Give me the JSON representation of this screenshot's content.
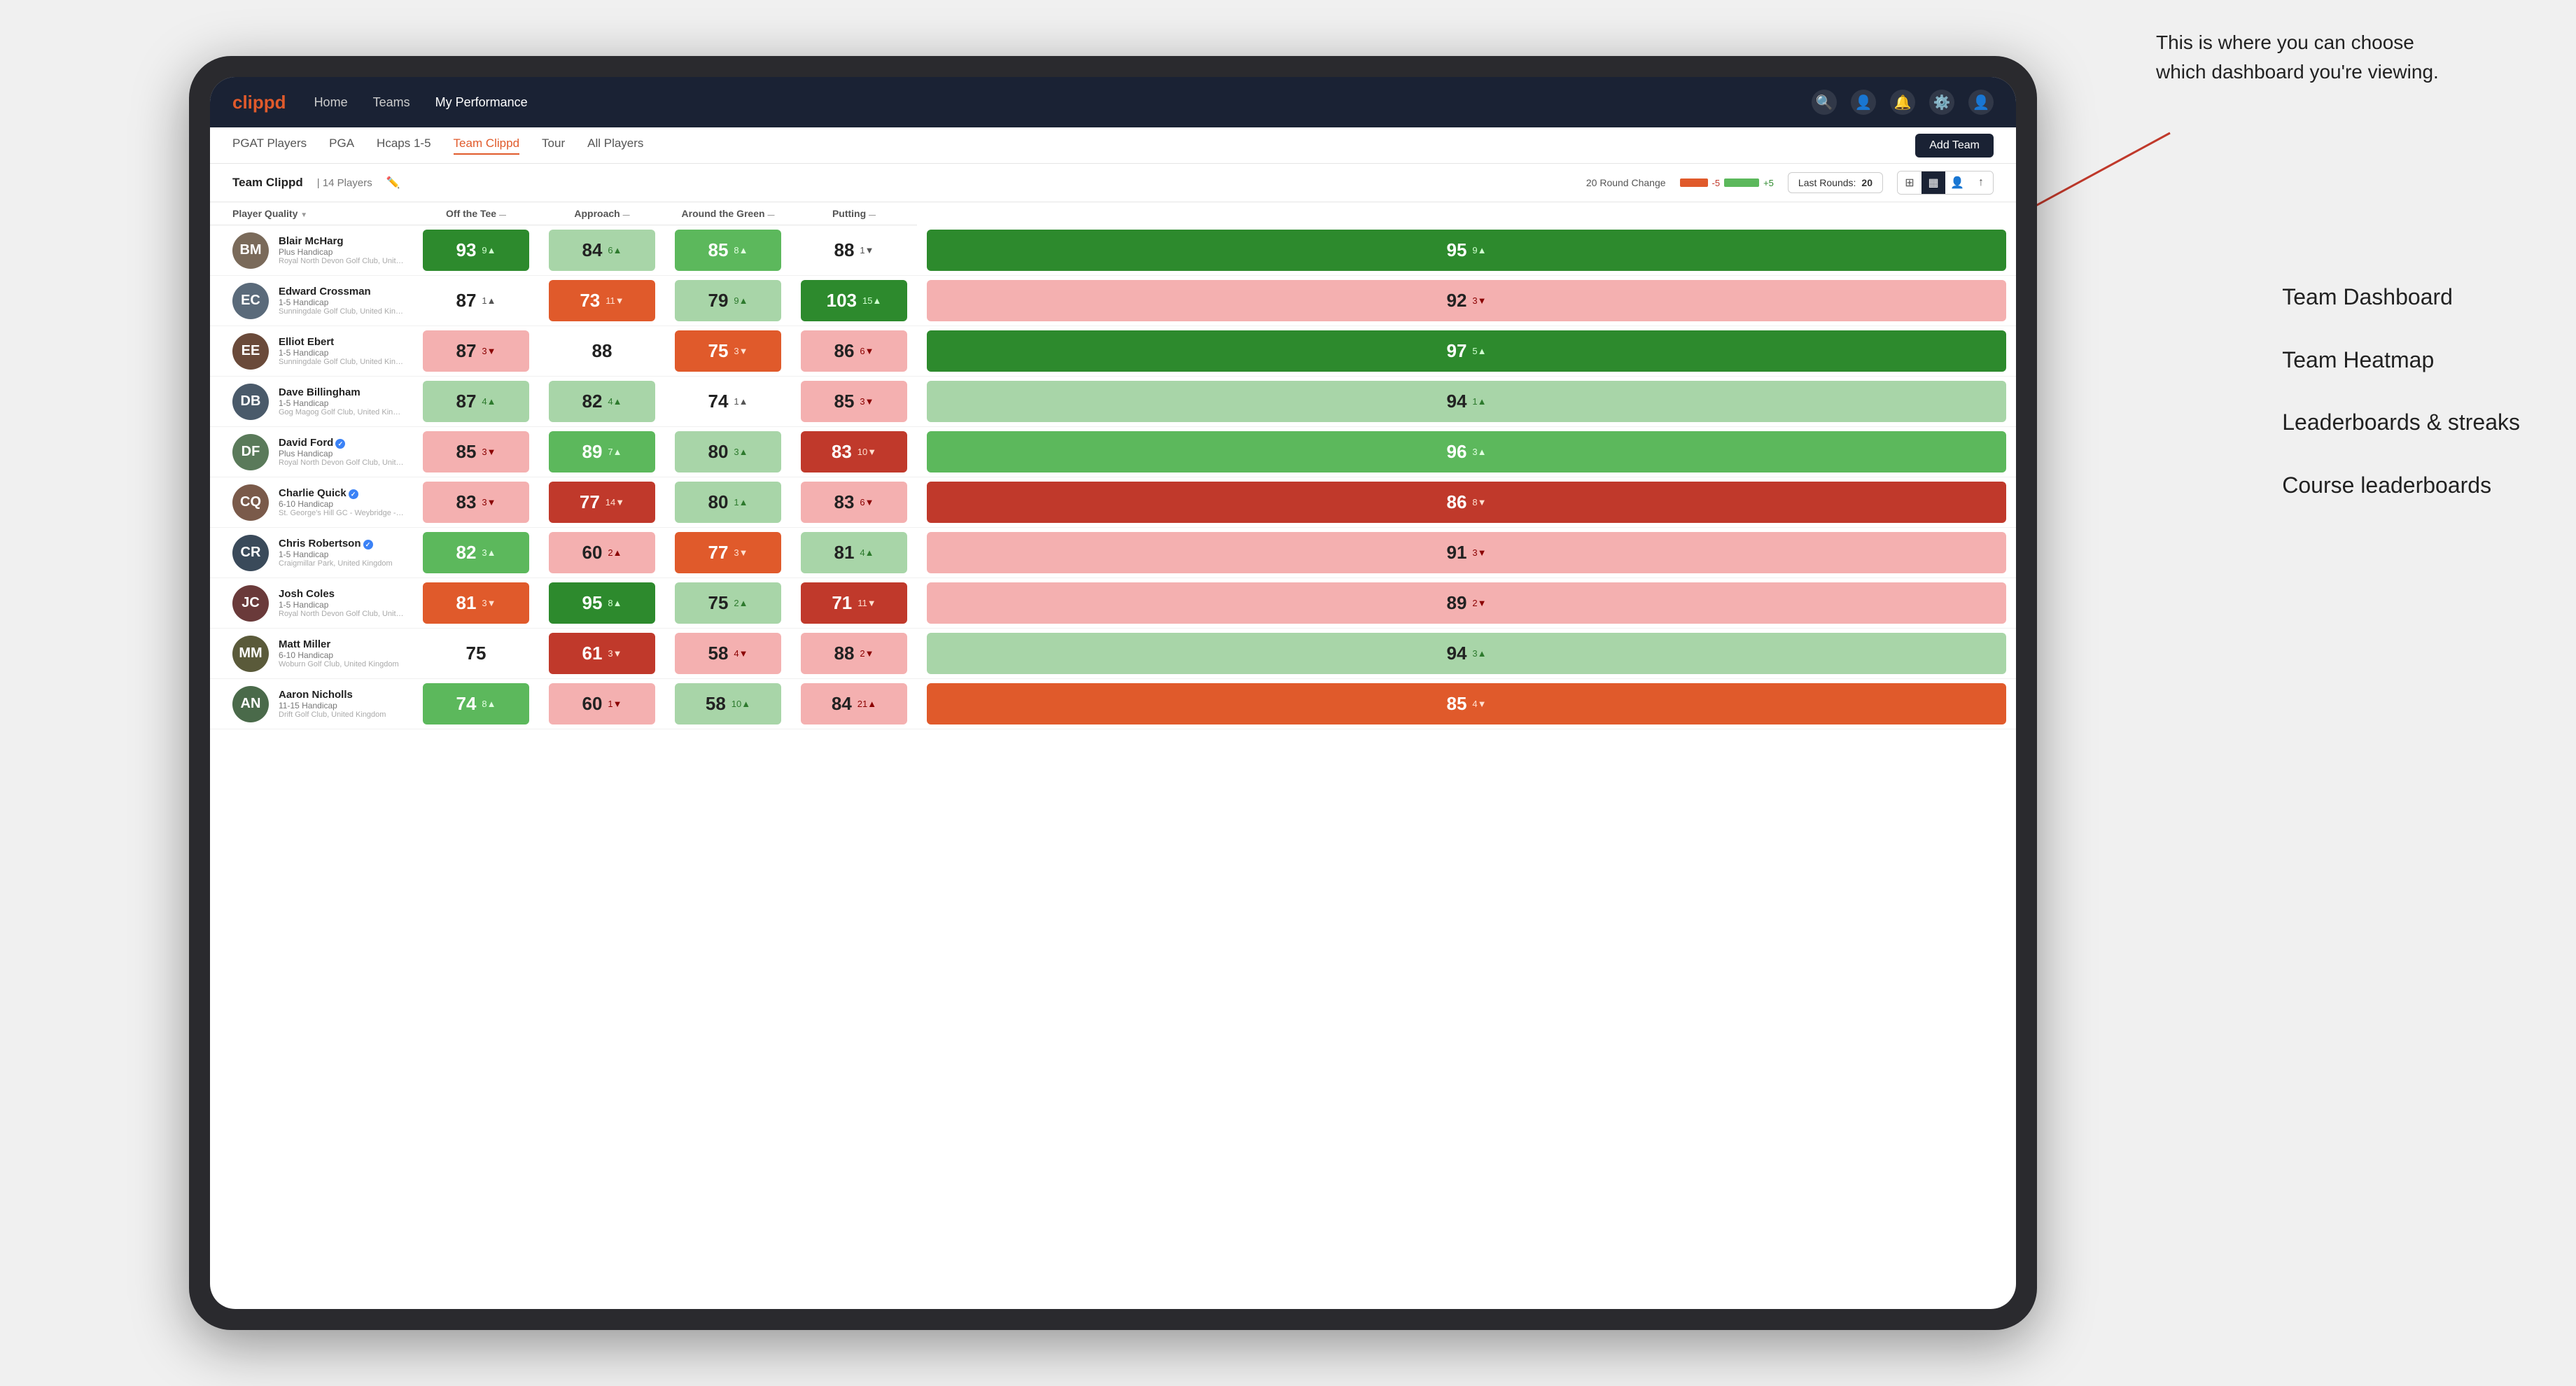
{
  "annotation": {
    "text": "This is where you can choose which dashboard you're viewing.",
    "labels": [
      "Team Dashboard",
      "Team Heatmap",
      "Leaderboards & streaks",
      "Course leaderboards"
    ]
  },
  "nav": {
    "logo": "clippd",
    "links": [
      "Home",
      "Teams",
      "My Performance"
    ],
    "active_link": "My Performance"
  },
  "sub_nav": {
    "links": [
      "PGAT Players",
      "PGA",
      "Hcaps 1-5",
      "Team Clippd",
      "Tour",
      "All Players"
    ],
    "active_link": "Team Clippd",
    "add_team_label": "Add Team"
  },
  "team_header": {
    "team_name": "Team Clippd",
    "separator": "|",
    "player_count": "14 Players",
    "round_change_label": "20 Round Change",
    "neg_val": "-5",
    "pos_val": "+5",
    "last_rounds_label": "Last Rounds:",
    "last_rounds_value": "20"
  },
  "columns": {
    "player": "Player Quality",
    "off_tee": "Off the Tee",
    "approach": "Approach",
    "around_green": "Around the Green",
    "putting": "Putting"
  },
  "players": [
    {
      "name": "Blair McHarg",
      "handicap": "Plus Handicap",
      "club": "Royal North Devon Golf Club, United Kingdom",
      "avatar_color": "#7a6a5a",
      "initials": "BM",
      "player_quality": {
        "value": "93",
        "change": "9",
        "dir": "up",
        "bg": "bg-green-strong"
      },
      "off_tee": {
        "value": "84",
        "change": "6",
        "dir": "up",
        "bg": "bg-green-light"
      },
      "approach": {
        "value": "85",
        "change": "8",
        "dir": "up",
        "bg": "bg-green-medium"
      },
      "around_green": {
        "value": "88",
        "change": "1",
        "dir": "down",
        "bg": "bg-white"
      },
      "putting": {
        "value": "95",
        "change": "9",
        "dir": "up",
        "bg": "bg-green-strong"
      }
    },
    {
      "name": "Edward Crossman",
      "handicap": "1-5 Handicap",
      "club": "Sunningdale Golf Club, United Kingdom",
      "avatar_color": "#5a6a7a",
      "initials": "EC",
      "player_quality": {
        "value": "87",
        "change": "1",
        "dir": "up",
        "bg": "bg-white"
      },
      "off_tee": {
        "value": "73",
        "change": "11",
        "dir": "down",
        "bg": "bg-red-medium"
      },
      "approach": {
        "value": "79",
        "change": "9",
        "dir": "up",
        "bg": "bg-green-light"
      },
      "around_green": {
        "value": "103",
        "change": "15",
        "dir": "up",
        "bg": "bg-green-strong"
      },
      "putting": {
        "value": "92",
        "change": "3",
        "dir": "down",
        "bg": "bg-red-light"
      }
    },
    {
      "name": "Elliot Ebert",
      "handicap": "1-5 Handicap",
      "club": "Sunningdale Golf Club, United Kingdom",
      "avatar_color": "#6a4a3a",
      "initials": "EE",
      "player_quality": {
        "value": "87",
        "change": "3",
        "dir": "down",
        "bg": "bg-red-light"
      },
      "off_tee": {
        "value": "88",
        "change": "",
        "dir": "neutral",
        "bg": "bg-white"
      },
      "approach": {
        "value": "75",
        "change": "3",
        "dir": "down",
        "bg": "bg-red-medium"
      },
      "around_green": {
        "value": "86",
        "change": "6",
        "dir": "down",
        "bg": "bg-red-light"
      },
      "putting": {
        "value": "97",
        "change": "5",
        "dir": "up",
        "bg": "bg-green-strong"
      }
    },
    {
      "name": "Dave Billingham",
      "handicap": "1-5 Handicap",
      "club": "Gog Magog Golf Club, United Kingdom",
      "avatar_color": "#4a5a6a",
      "initials": "DB",
      "player_quality": {
        "value": "87",
        "change": "4",
        "dir": "up",
        "bg": "bg-green-light"
      },
      "off_tee": {
        "value": "82",
        "change": "4",
        "dir": "up",
        "bg": "bg-green-light"
      },
      "approach": {
        "value": "74",
        "change": "1",
        "dir": "up",
        "bg": "bg-white"
      },
      "around_green": {
        "value": "85",
        "change": "3",
        "dir": "down",
        "bg": "bg-red-light"
      },
      "putting": {
        "value": "94",
        "change": "1",
        "dir": "up",
        "bg": "bg-green-light"
      }
    },
    {
      "name": "David Ford",
      "handicap": "Plus Handicap",
      "club": "Royal North Devon Golf Club, United Kingdom",
      "avatar_color": "#5a7a5a",
      "initials": "DF",
      "verified": true,
      "player_quality": {
        "value": "85",
        "change": "3",
        "dir": "down",
        "bg": "bg-red-light"
      },
      "off_tee": {
        "value": "89",
        "change": "7",
        "dir": "up",
        "bg": "bg-green-medium"
      },
      "approach": {
        "value": "80",
        "change": "3",
        "dir": "up",
        "bg": "bg-green-light"
      },
      "around_green": {
        "value": "83",
        "change": "10",
        "dir": "down",
        "bg": "bg-red-strong"
      },
      "putting": {
        "value": "96",
        "change": "3",
        "dir": "up",
        "bg": "bg-green-medium"
      }
    },
    {
      "name": "Charlie Quick",
      "handicap": "6-10 Handicap",
      "club": "St. George's Hill GC - Weybridge - Surrey, Uni...",
      "avatar_color": "#7a5a4a",
      "initials": "CQ",
      "verified": true,
      "player_quality": {
        "value": "83",
        "change": "3",
        "dir": "down",
        "bg": "bg-red-light"
      },
      "off_tee": {
        "value": "77",
        "change": "14",
        "dir": "down",
        "bg": "bg-red-strong"
      },
      "approach": {
        "value": "80",
        "change": "1",
        "dir": "up",
        "bg": "bg-green-light"
      },
      "around_green": {
        "value": "83",
        "change": "6",
        "dir": "down",
        "bg": "bg-red-light"
      },
      "putting": {
        "value": "86",
        "change": "8",
        "dir": "down",
        "bg": "bg-red-strong"
      }
    },
    {
      "name": "Chris Robertson",
      "handicap": "1-5 Handicap",
      "club": "Craigmillar Park, United Kingdom",
      "avatar_color": "#3a4a5a",
      "initials": "CR",
      "verified": true,
      "player_quality": {
        "value": "82",
        "change": "3",
        "dir": "up",
        "bg": "bg-green-medium"
      },
      "off_tee": {
        "value": "60",
        "change": "2",
        "dir": "up",
        "bg": "bg-red-light"
      },
      "approach": {
        "value": "77",
        "change": "3",
        "dir": "down",
        "bg": "bg-red-medium"
      },
      "around_green": {
        "value": "81",
        "change": "4",
        "dir": "up",
        "bg": "bg-green-light"
      },
      "putting": {
        "value": "91",
        "change": "3",
        "dir": "down",
        "bg": "bg-red-light"
      }
    },
    {
      "name": "Josh Coles",
      "handicap": "1-5 Handicap",
      "club": "Royal North Devon Golf Club, United Kingdom",
      "avatar_color": "#6a3a3a",
      "initials": "JC",
      "player_quality": {
        "value": "81",
        "change": "3",
        "dir": "down",
        "bg": "bg-red-medium"
      },
      "off_tee": {
        "value": "95",
        "change": "8",
        "dir": "up",
        "bg": "bg-green-strong"
      },
      "approach": {
        "value": "75",
        "change": "2",
        "dir": "up",
        "bg": "bg-green-light"
      },
      "around_green": {
        "value": "71",
        "change": "11",
        "dir": "down",
        "bg": "bg-red-strong"
      },
      "putting": {
        "value": "89",
        "change": "2",
        "dir": "down",
        "bg": "bg-red-light"
      }
    },
    {
      "name": "Matt Miller",
      "handicap": "6-10 Handicap",
      "club": "Woburn Golf Club, United Kingdom",
      "avatar_color": "#5a5a3a",
      "initials": "MM",
      "player_quality": {
        "value": "75",
        "change": "",
        "dir": "neutral",
        "bg": "bg-white"
      },
      "off_tee": {
        "value": "61",
        "change": "3",
        "dir": "down",
        "bg": "bg-red-strong"
      },
      "approach": {
        "value": "58",
        "change": "4",
        "dir": "down",
        "bg": "bg-red-light"
      },
      "around_green": {
        "value": "88",
        "change": "2",
        "dir": "down",
        "bg": "bg-red-light"
      },
      "putting": {
        "value": "94",
        "change": "3",
        "dir": "up",
        "bg": "bg-green-light"
      }
    },
    {
      "name": "Aaron Nicholls",
      "handicap": "11-15 Handicap",
      "club": "Drift Golf Club, United Kingdom",
      "avatar_color": "#4a6a4a",
      "initials": "AN",
      "player_quality": {
        "value": "74",
        "change": "8",
        "dir": "up",
        "bg": "bg-green-medium"
      },
      "off_tee": {
        "value": "60",
        "change": "1",
        "dir": "down",
        "bg": "bg-red-light"
      },
      "approach": {
        "value": "58",
        "change": "10",
        "dir": "up",
        "bg": "bg-green-light"
      },
      "around_green": {
        "value": "84",
        "change": "21",
        "dir": "up",
        "bg": "bg-red-light"
      },
      "putting": {
        "value": "85",
        "change": "4",
        "dir": "down",
        "bg": "bg-red-medium"
      }
    }
  ],
  "colors": {
    "bg_green_strong": "#2d8a2d",
    "bg_green_medium": "#5cb85c",
    "bg_green_light": "#a8d5a8",
    "bg_red_light": "#f4b0b0",
    "bg_red_medium": "#e05a2b",
    "bg_red_strong": "#c0392b",
    "bg_white": "#ffffff",
    "nav_bg": "#1a2234",
    "accent": "#e05a2b"
  }
}
